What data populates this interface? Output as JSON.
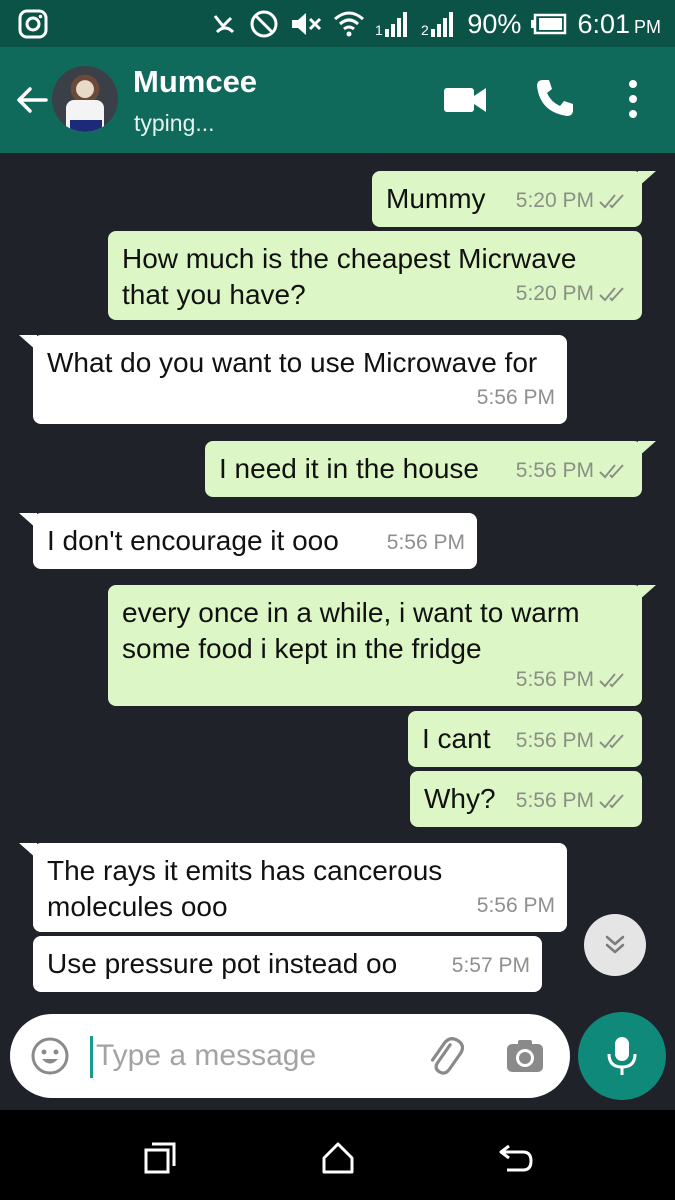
{
  "status_bar": {
    "battery": "90%",
    "time": "6:01",
    "ampm": "PM",
    "icons": [
      "instagram-icon",
      "missed-call-icon",
      "dnd-icon",
      "mute-icon",
      "wifi-icon",
      "signal-1-icon",
      "signal-2-icon",
      "battery-icon"
    ]
  },
  "header": {
    "contact_name": "Mumcee",
    "status": "typing...",
    "icons": [
      "back-arrow-icon",
      "video-call-icon",
      "phone-call-icon",
      "more-vert-icon"
    ]
  },
  "messages": [
    {
      "dir": "out",
      "text": "Mummy",
      "time": "5:20 PM",
      "status": "read"
    },
    {
      "dir": "out",
      "text": "How much is the cheapest Micrwave that you have?",
      "time": "5:20 PM",
      "status": "read"
    },
    {
      "dir": "in",
      "text": "What do you want to use Microwave for",
      "time": "5:56 PM"
    },
    {
      "dir": "out",
      "text": "I need it in the house",
      "time": "5:56 PM",
      "status": "read"
    },
    {
      "dir": "in",
      "text": "I don't encourage it ooo",
      "time": "5:56 PM"
    },
    {
      "dir": "out",
      "text": "every once in a while, i want to warm some food i kept in the fridge",
      "time": "5:56 PM",
      "status": "read"
    },
    {
      "dir": "out",
      "text": "I cant",
      "time": "5:56 PM",
      "status": "read"
    },
    {
      "dir": "out",
      "text": "Why?",
      "time": "5:56 PM",
      "status": "read"
    },
    {
      "dir": "in",
      "text": "The rays it emits has cancerous molecules ooo",
      "time": "5:56 PM"
    },
    {
      "dir": "in",
      "text": "Use pressure pot instead oo",
      "time": "5:57 PM"
    }
  ],
  "composer": {
    "placeholder": "Type a message",
    "value": ""
  },
  "colors": {
    "header": "#0f6a5c",
    "status_bar": "#0b5247",
    "chat_bg": "#1f2329",
    "outgoing_bubble": "#dcf7c5",
    "incoming_bubble": "#ffffff",
    "accent": "#0f8a7a"
  }
}
